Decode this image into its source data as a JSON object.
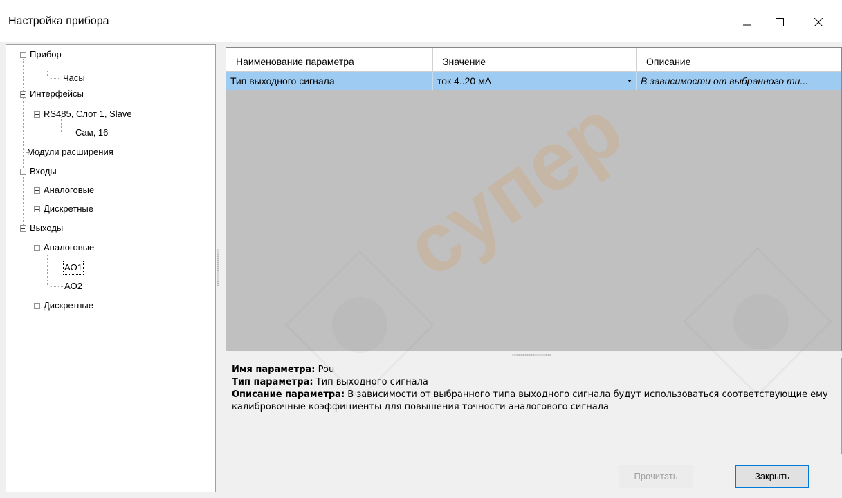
{
  "window": {
    "title": "Настройка прибора"
  },
  "tree": {
    "nodes": [
      {
        "label": "Прибор"
      },
      {
        "label": "Часы"
      },
      {
        "label": "Интерфейсы"
      },
      {
        "label": "RS485, Слот 1, Slave"
      },
      {
        "label": "Сам, 16"
      },
      {
        "label": "Модули расширения"
      },
      {
        "label": "Входы"
      },
      {
        "label": "Аналоговые"
      },
      {
        "label": "Дискретные"
      },
      {
        "label": "Выходы"
      },
      {
        "label": "Аналоговые"
      },
      {
        "label": "AO1"
      },
      {
        "label": "AO2"
      },
      {
        "label": "Дискретные"
      }
    ],
    "selected": "AO1"
  },
  "grid": {
    "columns": [
      "Наименование параметра",
      "Значение",
      "Описание"
    ],
    "rows": [
      {
        "name": "Тип выходного сигнала",
        "value": "ток 4..20 мА",
        "description": "В зависимости от выбранного ти..."
      }
    ],
    "selected_row_color": "#9ecbf1"
  },
  "details": {
    "name_label": "Имя параметра:",
    "name_value": "Pou",
    "type_label": "Тип параметра:",
    "type_value": "Тип выходного сигнала",
    "desc_label": "Описание параметра:",
    "desc_value": "В зависимости от выбранного типа выходного сигнала будут использоваться соответствующие ему калибровочные коэффициенты для повышения точности аналогового сигнала"
  },
  "buttons": {
    "read_label": "Прочитать",
    "read_enabled": false,
    "close_label": "Закрыть"
  },
  "watermark": {
    "brand_text": "супер"
  }
}
